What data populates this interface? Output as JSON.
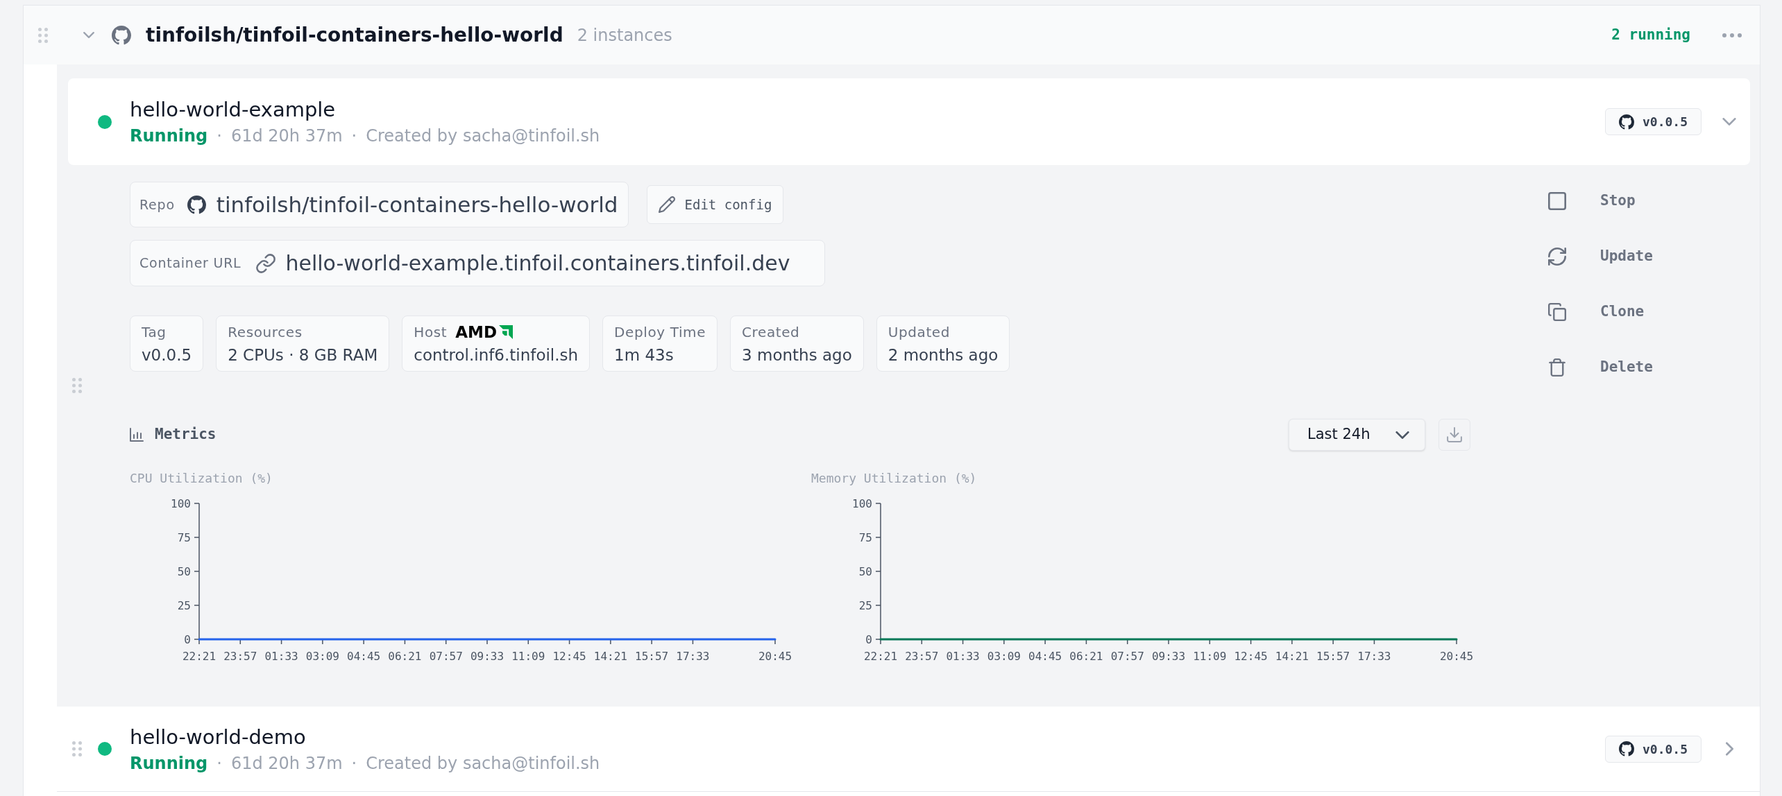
{
  "group": {
    "expanded": true,
    "repo": "tinfoilsh/tinfoil-containers-hello-world",
    "instance_count": "2 instances",
    "running_count": "2 running"
  },
  "instances": [
    {
      "name": "hello-world-example",
      "running": true,
      "status": "Running",
      "separators": [
        "·",
        "·"
      ],
      "uptime": "61d 20h 37m",
      "creator": "Created by sacha@tinfoil.sh",
      "version": "v0.0.5",
      "expanded": true,
      "details": {
        "repo": {
          "label": "Repo",
          "value": "tinfoilsh/tinfoil-containers-hello-world"
        },
        "edit_button": "Edit config",
        "container_url": {
          "label": "Container URL",
          "value": "hello-world-example.tinfoil.containers.tinfoil.dev"
        },
        "info": [
          {
            "label": "Tag",
            "value": "v0.0.5"
          },
          {
            "label": "Resources",
            "value": "2 CPUs · 8 GB RAM"
          },
          {
            "label": "Host",
            "vendor": "AMD",
            "value": "control.inf6.tinfoil.sh"
          },
          {
            "label": "Deploy Time",
            "value": "1m 43s"
          },
          {
            "label": "Created",
            "value": "3 months ago"
          },
          {
            "label": "Updated",
            "value": "2 months ago"
          }
        ],
        "actions": [
          {
            "kind": "stop",
            "label": "Stop"
          },
          {
            "kind": "update",
            "label": "Update"
          },
          {
            "kind": "clone",
            "label": "Clone"
          },
          {
            "kind": "delete",
            "label": "Delete"
          }
        ],
        "metrics": {
          "title": "Metrics",
          "range": "Last 24h",
          "charts": [
            {
              "chart_data": {
                "type": "line",
                "title": "CPU Utilization (%)",
                "categories": [
                  "22:21",
                  "23:57",
                  "01:33",
                  "03:09",
                  "04:45",
                  "06:21",
                  "07:57",
                  "09:33",
                  "11:09",
                  "12:45",
                  "14:21",
                  "15:57",
                  "17:33",
                  null,
                  "20:45"
                ],
                "series": [
                  {
                    "color": "#2563eb",
                    "values": [
                      0,
                      0,
                      0,
                      0,
                      0,
                      0,
                      0,
                      0,
                      0,
                      0,
                      0,
                      0,
                      0,
                      0,
                      0
                    ]
                  }
                ],
                "ylim": [
                  0,
                  100
                ],
                "yticks": [
                  0,
                  25,
                  50,
                  75,
                  100
                ]
              }
            },
            {
              "chart_data": {
                "type": "line",
                "title": "Memory Utilization (%)",
                "categories": [
                  "22:21",
                  "23:57",
                  "01:33",
                  "03:09",
                  "04:45",
                  "06:21",
                  "07:57",
                  "09:33",
                  "11:09",
                  "12:45",
                  "14:21",
                  "15:57",
                  "17:33",
                  null,
                  "20:45"
                ],
                "series": [
                  {
                    "color": "#047857",
                    "values": [
                      0,
                      0,
                      0,
                      0,
                      0,
                      0,
                      0,
                      0,
                      0,
                      0,
                      0,
                      0,
                      0,
                      0,
                      0
                    ]
                  }
                ],
                "ylim": [
                  0,
                  100
                ],
                "yticks": [
                  0,
                  25,
                  50,
                  75,
                  100
                ]
              }
            }
          ]
        }
      }
    },
    {
      "name": "hello-world-demo",
      "running": true,
      "status": "Running",
      "separators": [
        "·",
        "·"
      ],
      "uptime": "61d 20h 37m",
      "creator": "Created by sacha@tinfoil.sh",
      "version": "v0.0.5",
      "expanded": false
    }
  ]
}
